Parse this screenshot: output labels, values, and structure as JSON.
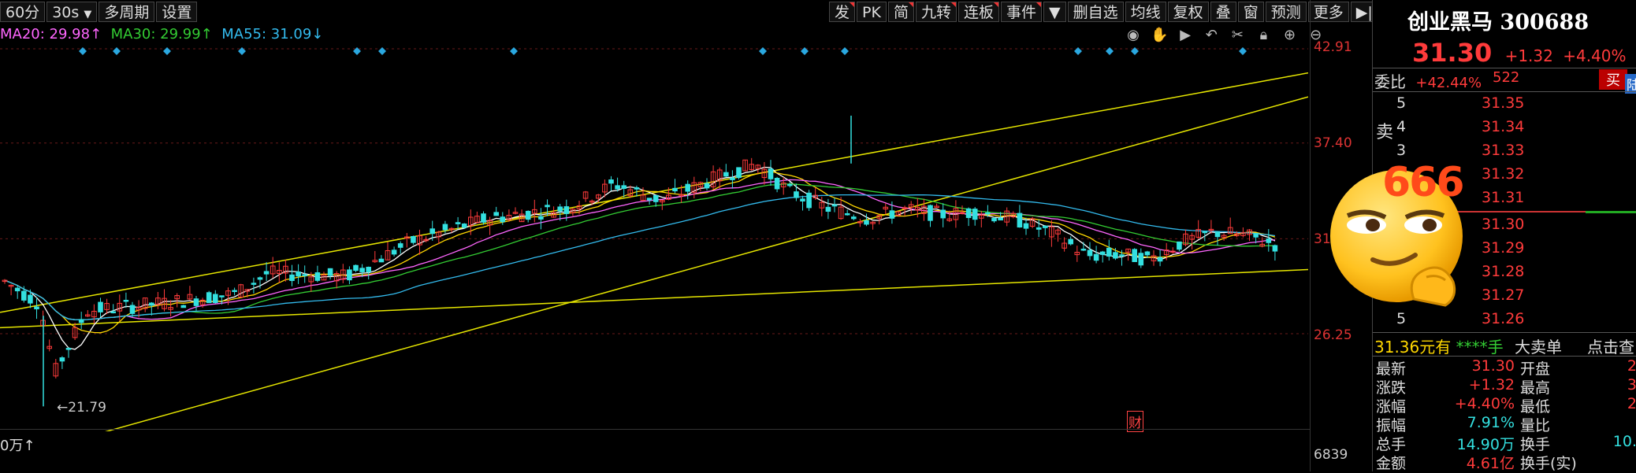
{
  "toolbar_left": [
    "60分",
    "30s",
    "多周期",
    "设置"
  ],
  "toolbar_right": [
    "发",
    "PK",
    "简",
    "九转",
    "连板",
    "事件",
    "删自选",
    "均线",
    "复权",
    "叠",
    "窗",
    "预测",
    "更多"
  ],
  "ma": {
    "ma20": "MA20: 29.98↑",
    "ma30": "MA30: 29.99↑",
    "ma55": "MA55: 31.09↓"
  },
  "y_axis": [
    "42.91",
    "37.40",
    "31",
    "26.25"
  ],
  "vol_axis": "6839",
  "low_marker": "←21.79",
  "vol_label": "0万↑",
  "event_marker": "财",
  "stock": {
    "name": "创业黑马",
    "code": "300688",
    "price": "31.30",
    "change": "+1.32",
    "pct": "+4.40%",
    "weibi_label": "委比",
    "weibi_value": "+42.44%",
    "weicha": "522",
    "buy_label": "买",
    "lu_label": "陆"
  },
  "sell_side_label": "卖",
  "sell_levels": [
    {
      "level": "5",
      "price": "31.35"
    },
    {
      "level": "4",
      "price": "31.34"
    },
    {
      "level": "3",
      "price": "31.33"
    },
    {
      "level": "2",
      "price": "31.32"
    },
    {
      "level": "1",
      "price": "31.31"
    }
  ],
  "buy_levels": [
    {
      "level": "1",
      "price": "31.30"
    },
    {
      "level": "2",
      "price": "31.29"
    },
    {
      "level": "3",
      "price": "31.28"
    },
    {
      "level": "4",
      "price": "31.27"
    },
    {
      "level": "5",
      "price": "31.26"
    }
  ],
  "big_order": {
    "price": "31.36元有",
    "qty": "****手",
    "label": "大卖单",
    "action": "点击查"
  },
  "stats": [
    {
      "l1": "最新",
      "v1": "31.30",
      "l2": "开盘",
      "v2": "2"
    },
    {
      "l1": "涨跌",
      "v1": "+1.32",
      "l2": "最高",
      "v2": "3"
    },
    {
      "l1": "涨幅",
      "v1": "+4.40%",
      "l2": "最低",
      "v2": "2"
    },
    {
      "l1": "振幅",
      "v1": "7.91%",
      "l2": "量比",
      "v2": ""
    },
    {
      "l1": "总手",
      "v1": "14.90万",
      "l2": "换手",
      "v2": "10."
    },
    {
      "l1": "金额",
      "v1": "4.61亿",
      "l2": "换手(实)",
      "v2": ""
    }
  ],
  "emoji_text": "666",
  "colors": {
    "up": "#ff3b3b",
    "down": "#33e0e0",
    "ma5": "#ffffff",
    "ma10": "#ffd700",
    "ma20": "#ff66ff",
    "ma30": "#33cc33",
    "ma55": "#33bbee",
    "channel": "#e6e600"
  }
}
